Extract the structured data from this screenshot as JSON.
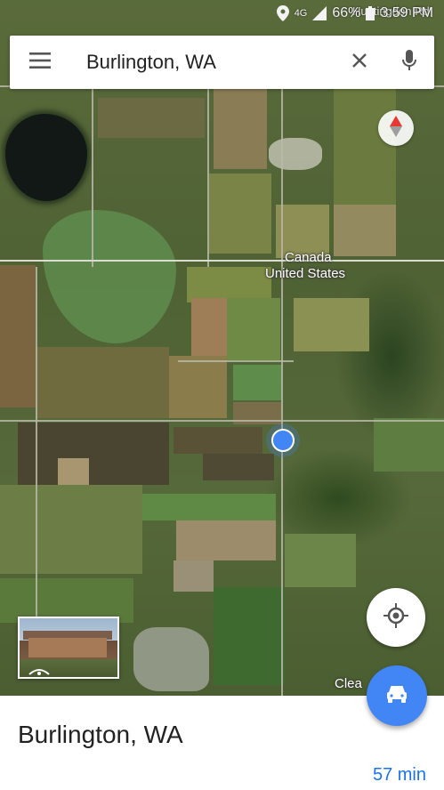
{
  "status_bar": {
    "network": "4G",
    "battery": "66%",
    "time": "3:59 PM"
  },
  "search": {
    "query": "Burlington, WA",
    "menu_icon": "menu-icon",
    "clear_icon": "close-icon",
    "mic_icon": "microphone-icon"
  },
  "map": {
    "labels": {
      "country_north": "Canada",
      "country_south": "United States",
      "road_top": "Huntingdon Rd",
      "place_bottom": "Clea"
    },
    "compass_icon": "compass-icon",
    "my_location_icon": "my-location-icon",
    "location_dot_color": "#4285f4"
  },
  "place": {
    "title": "Burlington, WA",
    "eta": "57 min",
    "directions_icon": "car-icon",
    "accent_color": "#4285f4"
  }
}
